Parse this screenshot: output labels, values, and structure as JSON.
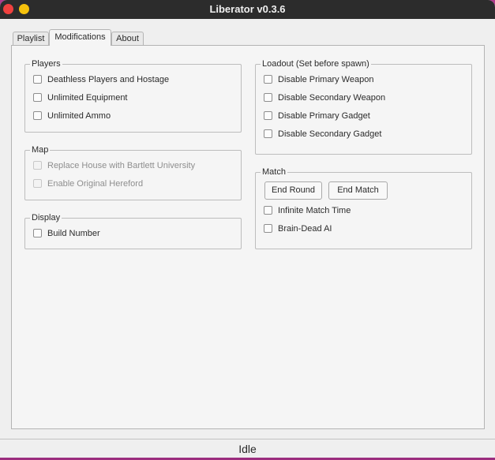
{
  "window": {
    "title": "Liberator v0.3.6",
    "accent_color": "#b03a8c",
    "close_color": "#f0413f",
    "minimize_color": "#f5c10c"
  },
  "tabs": [
    {
      "label": "Playlist",
      "active": false
    },
    {
      "label": "Modifications",
      "active": true
    },
    {
      "label": "About",
      "active": false
    }
  ],
  "players": {
    "title": "Players",
    "items": [
      {
        "label": "Deathless Players and Hostage",
        "checked": false
      },
      {
        "label": "Unlimited Equipment",
        "checked": false
      },
      {
        "label": "Unlimited Ammo",
        "checked": false
      }
    ]
  },
  "map": {
    "title": "Map",
    "items": [
      {
        "label": "Replace House with Bartlett University",
        "checked": false,
        "disabled": true
      },
      {
        "label": "Enable Original Hereford",
        "checked": false,
        "disabled": true
      }
    ]
  },
  "display": {
    "title": "Display",
    "items": [
      {
        "label": "Build Number",
        "checked": false
      }
    ]
  },
  "loadout": {
    "title": "Loadout (Set before spawn)",
    "items": [
      {
        "label": "Disable Primary Weapon",
        "checked": false
      },
      {
        "label": "Disable Secondary Weapon",
        "checked": false
      },
      {
        "label": "Disable Primary Gadget",
        "checked": false
      },
      {
        "label": "Disable Secondary Gadget",
        "checked": false
      }
    ]
  },
  "match": {
    "title": "Match",
    "buttons": {
      "end_round": "End Round",
      "end_match": "End Match"
    },
    "items": [
      {
        "label": "Infinite Match Time",
        "checked": false
      },
      {
        "label": "Brain-Dead AI",
        "checked": false
      }
    ]
  },
  "status": {
    "text": "Idle"
  }
}
